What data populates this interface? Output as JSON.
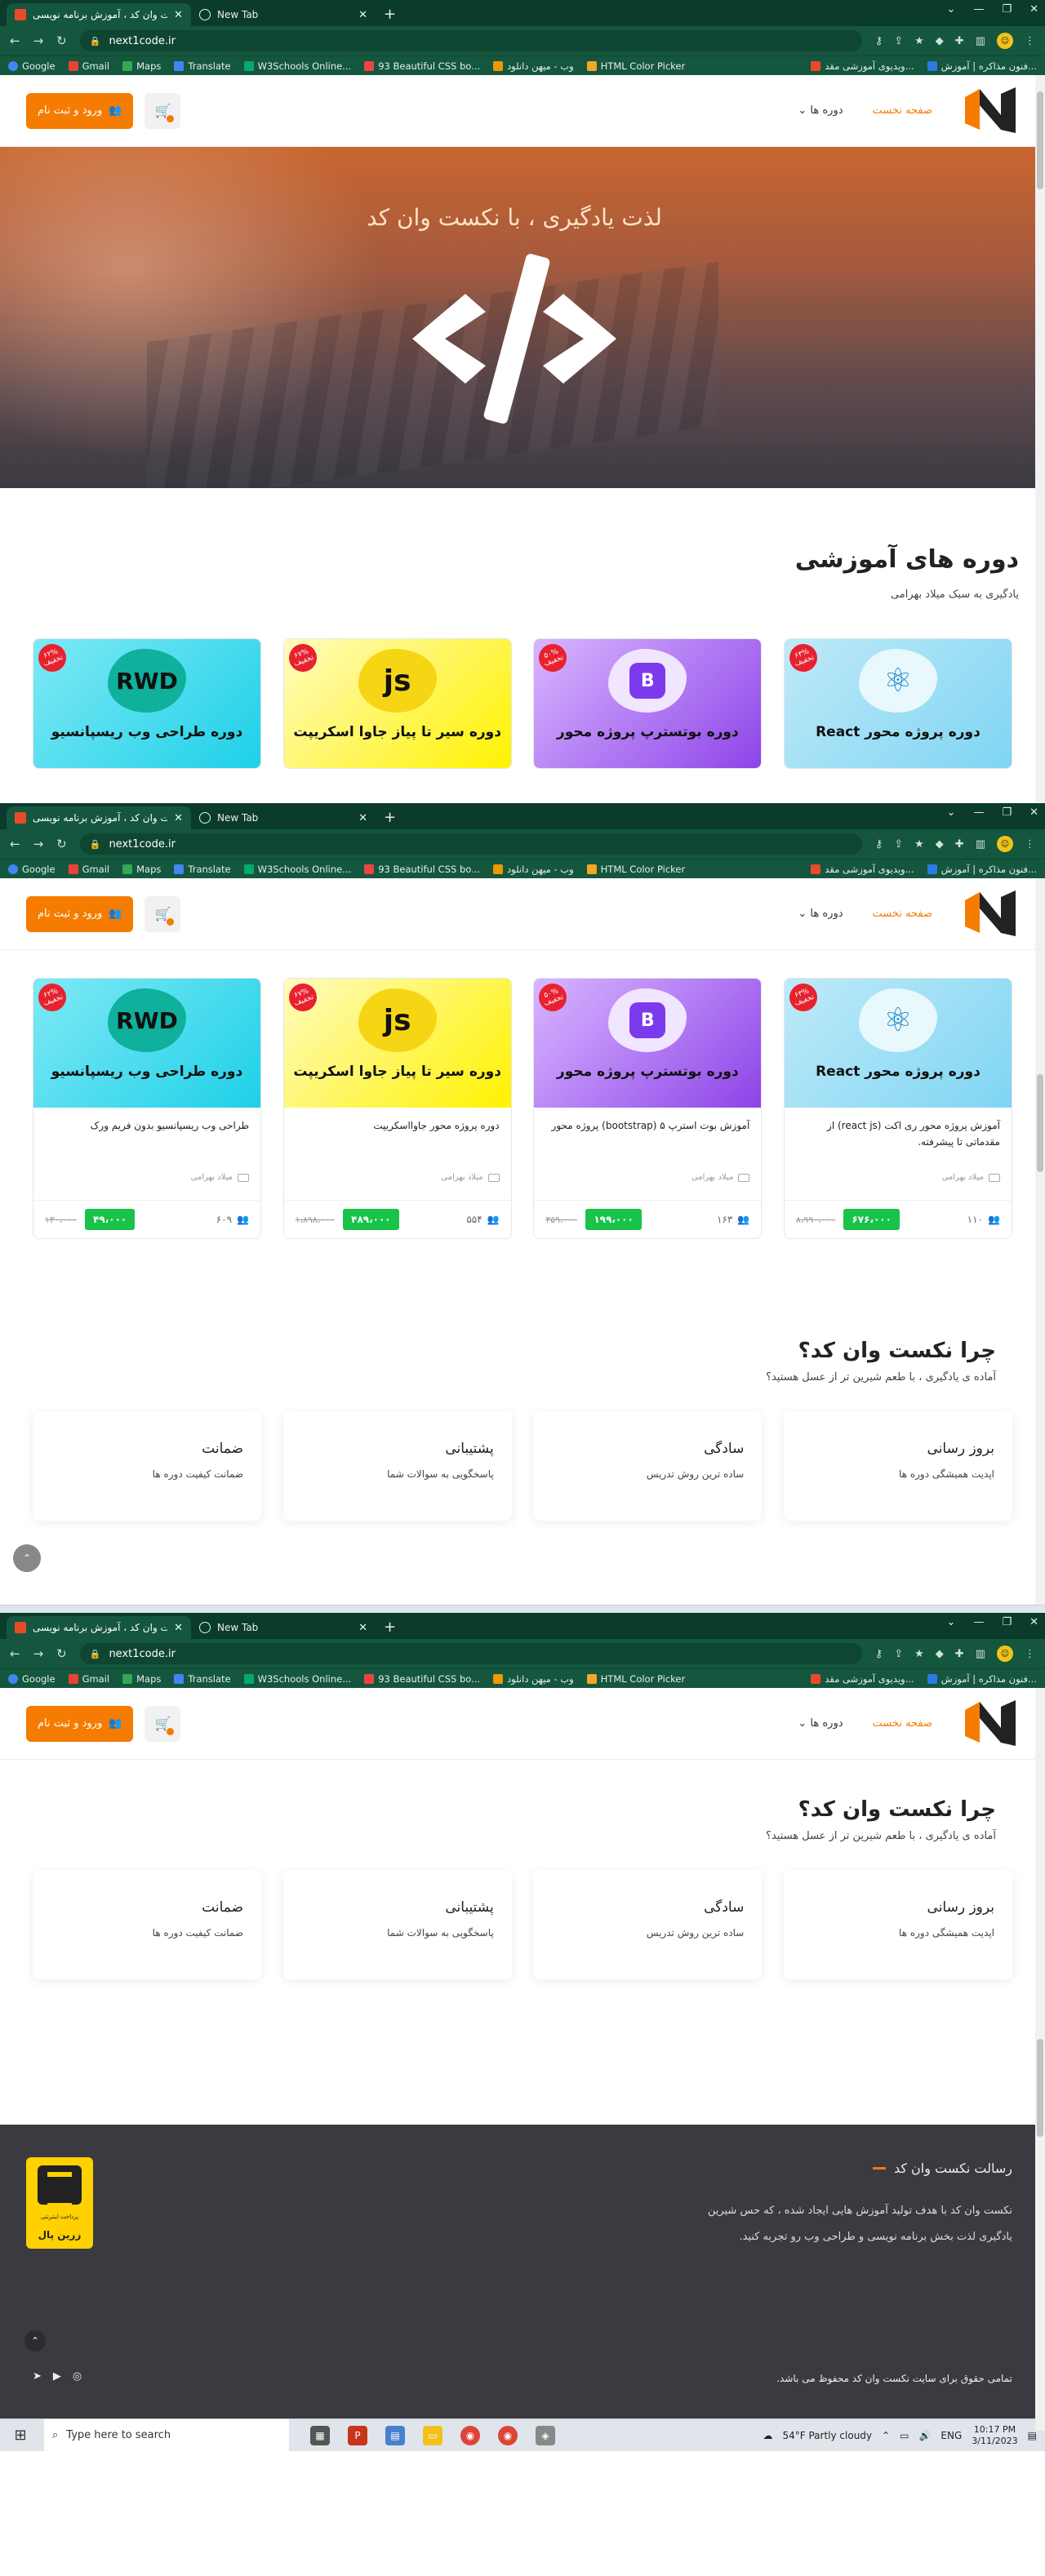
{
  "browser": {
    "tabs": [
      {
        "title": "نکست وان کد ، آموزش برنامه نویسی"
      },
      {
        "title": "New Tab"
      }
    ],
    "tab1_short": "نکست وان کد ، آموزش برنامه نویسی",
    "url": "next1code.ir",
    "bookmarks": [
      "Google",
      "Gmail",
      "Maps",
      "Translate",
      "W3Schools Online...",
      "93 Beautiful CSS bo...",
      "وب - میهن دانلود",
      "HTML Color Picker"
    ],
    "bookmarks_right": [
      "ویدیوی آموزشی مقد...",
      "فنون مذاکره | آموزش..."
    ]
  },
  "header": {
    "login_label": "ورود و ثبت نام",
    "nav_home": "صفحه نخست",
    "nav_courses": "دوره ها"
  },
  "hero": {
    "title": "لذت یادگیری ، با نکست وان کد"
  },
  "courses": {
    "title": "دوره های آموزشی",
    "subtitle": "یادگیری به سبک میلاد بهرامی",
    "items": [
      {
        "banner": "دوره پروژه محور React",
        "title": "آموزش پروژه محور ری اکت (react js) از مقدماتی تا پیشرفته.",
        "teacher": "میلاد بهرامی",
        "students": "۱۱۰",
        "price": "۶۷۶،۰۰۰",
        "old_price": "۸،۹۹۰،۰۰۰",
        "discount": "۶۳%\nتخفیف"
      },
      {
        "banner": "دوره بوتسترپ پروژه محور",
        "title": "آموزش بوت استرپ ۵ (bootstrap) پروژه محور",
        "teacher": "میلاد بهرامی",
        "students": "۱۶۳",
        "price": "۱۹۹،۰۰۰",
        "old_price": "۳۵۹،۰۰۰",
        "discount": "۵۰%\nتخفیف"
      },
      {
        "banner": "دوره سیر تا پیاز جاوا اسکریپت",
        "title": "دوره پروژه محور جاوااسکریپت",
        "teacher": "میلاد بهرامی",
        "students": "۵۵۴",
        "price": "۴۸۹،۰۰۰",
        "old_price": "۱،۸۹۸،۰۰۰",
        "discount": "۶۷%\nتخفیف"
      },
      {
        "banner": "دوره طراحی وب ریسپانسیو",
        "title": "طراحی وب ریسپانسیو بدون فریم ورک",
        "teacher": "میلاد بهرامی",
        "students": "۶۰۹",
        "price": "۴۹،۰۰۰",
        "old_price": "۱۳۰،۰۰۰",
        "discount": "۶۲%\nتخفیف"
      }
    ]
  },
  "why": {
    "title": "چرا نکست وان کد؟",
    "subtitle": "آماده ی یادگیری ، با طعم شیرین تر از عسل هستید؟",
    "features": [
      {
        "title": "بروز رسانی",
        "text": "اپدیت همیشگی دوره ها"
      },
      {
        "title": "سادگی",
        "text": "ساده ترین روش تدریس"
      },
      {
        "title": "پشتیبانی",
        "text": "پاسخگویی به سوالات شما"
      },
      {
        "title": "ضمانت",
        "text": "ضمانت کیفیت دوره ها"
      }
    ]
  },
  "footer": {
    "title": "رسالت نکست وان کد",
    "text": "نکست وان کد با هدف تولید آموزش هایی ایجاد شده ، که حس شیرین یادگیری لذت بخش برنامه نویسی و طراحی وب رو تجربه کنید.",
    "rights": "تمامی حقوق برای سایت نکست وان کد محفوظ می باشد.",
    "zarinpal_name": "زرین پال",
    "zarinpal_sub": "پرداخت اینترنتی"
  },
  "taskbar": {
    "search_placeholder": "Type here to search",
    "weather": "54°F  Partly cloudy",
    "lang": "ENG",
    "time": "10:17 PM",
    "date": "3/11/2023"
  },
  "colors": {
    "accent": "#f57c00",
    "chrome": "#14563e",
    "price_green": "#19c34a",
    "footer_bg": "#3a3a40"
  }
}
